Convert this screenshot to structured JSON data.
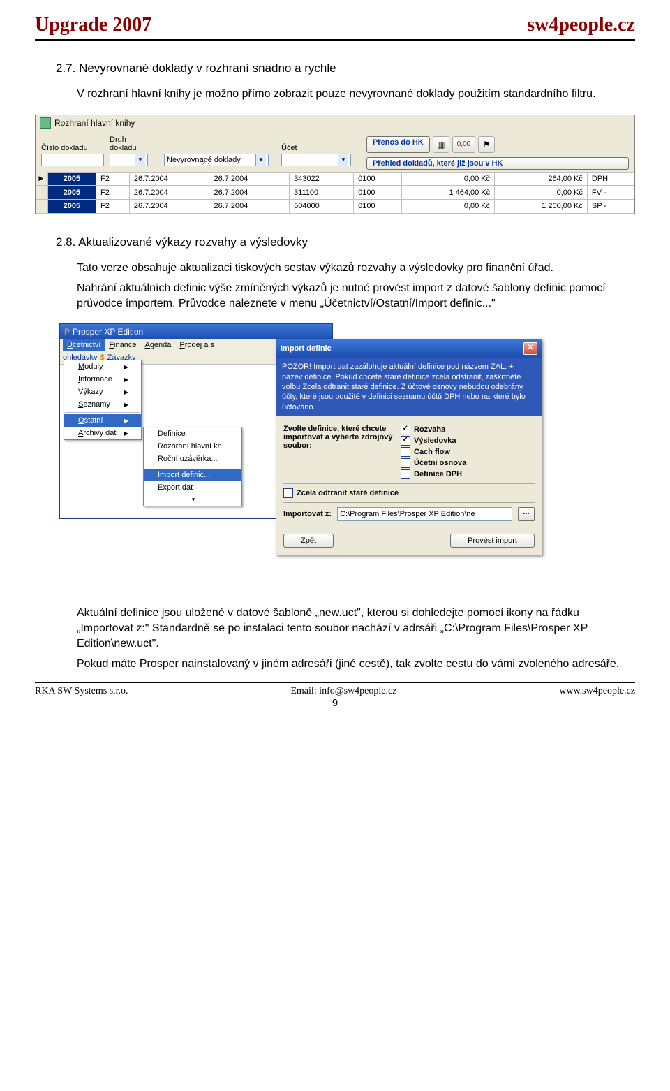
{
  "header": {
    "left": "Upgrade 2007",
    "right": "sw4people.cz"
  },
  "s27": {
    "title": "2.7. Nevyrovnané doklady v rozhraní snadno a rychle",
    "p": "V rozhraní hlavní knihy je možno přímo zobrazit pouze nevyrovnané doklady použitím standardního filtru."
  },
  "app1": {
    "title": "Rozhraní hlavní knihy",
    "cols": {
      "cislo": "Číslo dokladu",
      "druh": "Druh\ndokladu",
      "ucet": "Účet"
    },
    "filter_val": "Nevyrovnané doklady",
    "btn1": "Přenos do HK",
    "btn2": "Přehled dokladů, které již jsou v HK",
    "badge": "0,00",
    "rows": [
      {
        "y": "2005",
        "d": "F2",
        "a": "26.7.2004",
        "b": "26.7.2004",
        "c": "343022",
        "e": "0100",
        "f": "0,00 Kč",
        "g": "264,00 Kč",
        "h": "DPH"
      },
      {
        "y": "2005",
        "d": "F2",
        "a": "26.7.2004",
        "b": "26.7.2004",
        "c": "311100",
        "e": "0100",
        "f": "1 464,00 Kč",
        "g": "0,00 Kč",
        "h": "FV -"
      },
      {
        "y": "2005",
        "d": "F2",
        "a": "26.7.2004",
        "b": "26.7.2004",
        "c": "604000",
        "e": "0100",
        "f": "0,00 Kč",
        "g": "1 200,00 Kč",
        "h": "SP -"
      }
    ]
  },
  "s28": {
    "title": "2.8. Aktualizované výkazy rozvahy a výsledovky",
    "p1": "Tato verze obsahuje aktualizaci tiskových sestav výkazů rozvahy a výsledovky pro finanční úřad.",
    "p2": "Nahrání aktuálních definic výše zmíněných výkazů je nutné provést import z datové šablony definic pomocí průvodce importem. Průvodce naleznete v menu „Účetnictví/Ostatní/Import definic...\""
  },
  "app2": {
    "win_title": "Prosper XP Edition",
    "menubar": [
      "Účetnictví",
      "Finance",
      "Agenda",
      "Prodej a s"
    ],
    "toolbar": [
      "ohledávky",
      "Závazky"
    ],
    "menu1": [
      {
        "t": "Moduly",
        "a": true
      },
      {
        "t": "Informace",
        "a": true
      },
      {
        "t": "Výkazy",
        "a": true
      },
      {
        "t": "Seznamy",
        "a": true
      },
      {
        "sep": true
      },
      {
        "t": "Ostatní",
        "a": true,
        "hl": true
      },
      {
        "t": "Archivy dat",
        "a": true
      }
    ],
    "menu2": [
      {
        "t": "Definice"
      },
      {
        "t": "Rozhraní hlavní kn"
      },
      {
        "t": "Roční uzávěrka..."
      },
      {
        "sep": true
      },
      {
        "t": "Import definic...",
        "hl": true
      },
      {
        "t": "Export dat"
      },
      {
        "chev": true
      }
    ],
    "dlg": {
      "title": "Import definic",
      "warn": "POZOR! Import dat zazálohuje aktuální definice pod názvem ZAL: + název definice. Pokud chcete staré definice zcela odstranit, zaškrtněte volbu Zcela odtranit staré definice. Z účtové osnovy nebudou odebrány účty, které jsou použité v definici seznamu účtů DPH nebo na které bylo účtováno.",
      "label_choose": "Zvolte definice, které chcete importovat a vyberte zdrojový soubor:",
      "checks": [
        {
          "t": "Rozvaha",
          "on": true
        },
        {
          "t": "Výsledovka",
          "on": true
        },
        {
          "t": "Cach flow",
          "on": false
        },
        {
          "t": "Účetní osnova",
          "on": false
        },
        {
          "t": "Definice DPH",
          "on": false
        }
      ],
      "remove_old": {
        "t": "Zcela odtranit staré definice",
        "on": false
      },
      "import_from_label": "Importovat z:",
      "import_from_value": "C:\\Program Files\\Prosper XP Edition\\ne",
      "btn_back": "Zpět",
      "btn_go": "Provést import"
    }
  },
  "para3": "Aktuální definice jsou uložené v datové šabloně „new.uct\", kterou si dohledejte pomocí ikony na řádku „Importovat z:\" Standardně se po instalaci tento soubor nachází v adrsáři „C:\\Program Files\\Prosper XP Edition\\new.uct\".",
  "para4": "Pokud máte Prosper nainstalovaný v jiném adresáři (jiné cestě), tak zvolte cestu do vámi zvoleného adresáře.",
  "footer": {
    "left": "RKA SW Systems s.r.o.",
    "mid": "Email: info@sw4people.cz",
    "right": "www.sw4people.cz",
    "page": "9"
  }
}
